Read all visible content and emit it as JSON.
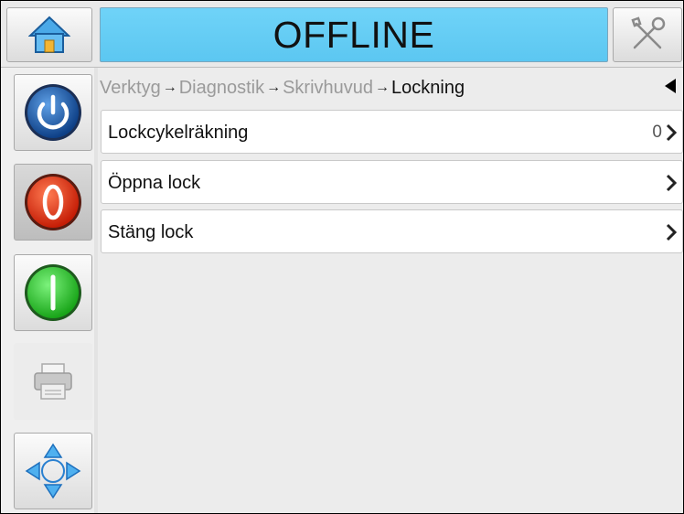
{
  "header": {
    "status": "OFFLINE",
    "home_icon": "home-icon",
    "tools_icon": "tools-icon"
  },
  "sidebar": {
    "items": [
      {
        "name": "power",
        "icon": "power-icon"
      },
      {
        "name": "stop",
        "icon": "stop-icon"
      },
      {
        "name": "start",
        "icon": "start-icon"
      },
      {
        "name": "print",
        "icon": "printer-icon"
      },
      {
        "name": "navigate",
        "icon": "navigation-arrows-icon"
      }
    ]
  },
  "breadcrumb": {
    "items": [
      "Verktyg",
      "Diagnostik",
      "Skrivhuvud"
    ],
    "current": "Lockning",
    "separator": "→"
  },
  "menu": {
    "rows": [
      {
        "label": "Lockcykelräkning",
        "value": "0"
      },
      {
        "label": "Öppna lock",
        "value": ""
      },
      {
        "label": "Stäng lock",
        "value": ""
      }
    ]
  },
  "colors": {
    "status_bg": "#5cc7f1",
    "power": "#1f63b8",
    "stop": "#e53a1a",
    "start": "#2fc32f"
  }
}
